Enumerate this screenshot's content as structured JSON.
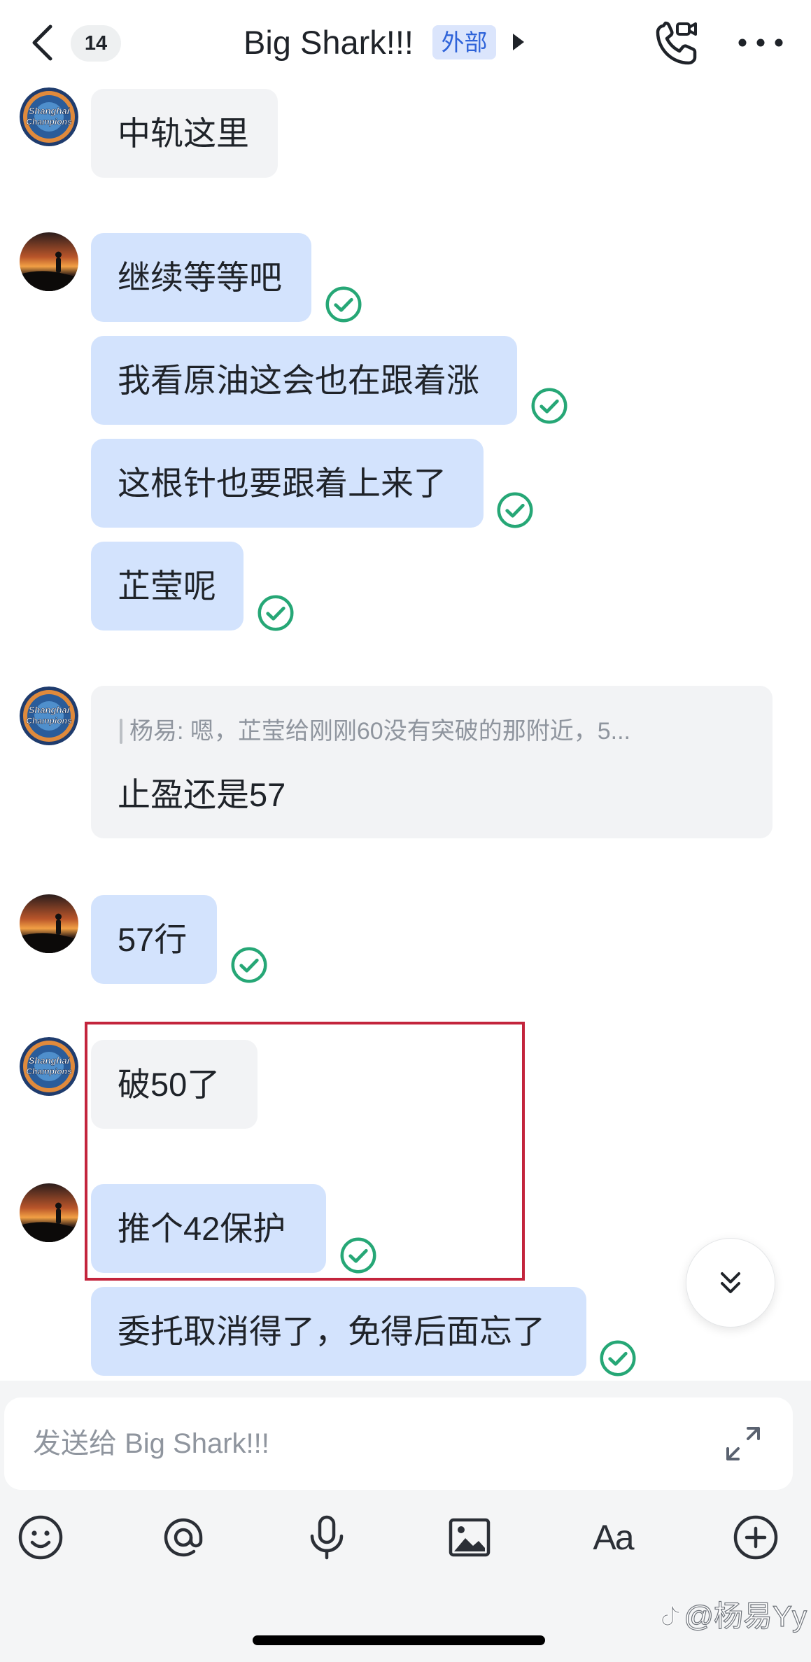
{
  "header": {
    "back_icon": "chevron-left-icon",
    "unread_count": "14",
    "title": "Big Shark!!!",
    "external_tag": "外部",
    "expand_icon": "caret-right-icon",
    "call_icon": "phone-video-call-icon",
    "more_icon": "more-icon"
  },
  "avatars": {
    "contact": {
      "icon": "shanghai-champions-logo",
      "logo_line1": "Shanghai",
      "logo_line2": "Champions"
    },
    "self": {
      "icon": "sunset-photo-avatar"
    }
  },
  "messages": [
    {
      "outgoing": false,
      "text": "中轨这里"
    },
    {
      "outgoing": true,
      "read": true,
      "text": "继续等等吧"
    },
    {
      "outgoing": true,
      "read": true,
      "text": "我看原油这会也在跟着涨"
    },
    {
      "outgoing": true,
      "read": true,
      "text": "这根针也要跟着上来了"
    },
    {
      "outgoing": true,
      "read": true,
      "text": "芷莹呢"
    },
    {
      "outgoing": false,
      "quote": "杨易: 嗯，芷莹给刚刚60没有突破的那附近，5...",
      "text": "止盈还是57"
    },
    {
      "outgoing": true,
      "read": true,
      "text": "57行"
    },
    {
      "outgoing": false,
      "highlighted": true,
      "text": "破50了"
    },
    {
      "outgoing": true,
      "read": true,
      "highlighted": true,
      "text": "推个42保护"
    },
    {
      "outgoing": true,
      "read": true,
      "text": "委托取消得了，免得后面忘了"
    }
  ],
  "scroll_button": {
    "icon": "double-chevron-down-icon"
  },
  "composer": {
    "placeholder": "发送给 Big Shark!!!",
    "expand_icon": "expand-arrows-icon"
  },
  "toolbar": {
    "items": [
      {
        "icon": "emoji-icon"
      },
      {
        "icon": "at-mention-icon"
      },
      {
        "icon": "microphone-icon"
      },
      {
        "icon": "image-icon"
      },
      {
        "icon": "text-format-icon",
        "label": "Aa"
      },
      {
        "icon": "plus-circle-icon"
      }
    ]
  },
  "watermark": {
    "text": "@杨易Yy",
    "logo_icon": "platform-logo-icon"
  },
  "colors": {
    "outgoing_bubble": "#d3e3fd",
    "incoming_bubble": "#f2f3f5",
    "read_check": "#26a776",
    "highlight_border": "#c3243c",
    "external_tag_text": "#2e63d9"
  }
}
